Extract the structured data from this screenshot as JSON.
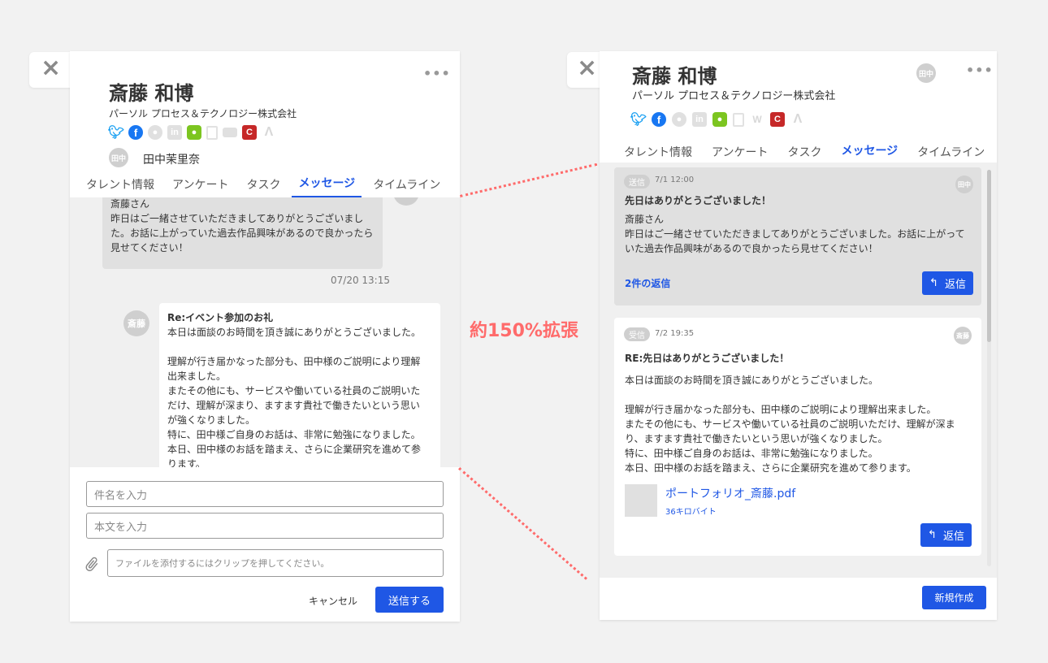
{
  "left": {
    "close_icon": "×",
    "menu_icon": "•••",
    "profile_name": "斎藤 和博",
    "company": "パーソル プロセス＆テクノロジー株式会社",
    "owner_avatar": "田中",
    "owner_name": "田中茉里奈",
    "tabs": [
      "タレント情報",
      "アンケート",
      "タスク",
      "メッセージ",
      "タイムライン"
    ],
    "active_tab": "メッセージ",
    "message1": {
      "text": "斎藤さん\n昨日はご一緒させていただきましてありがとうございまし\nた。お話に上がっていた過去作品興味があるので良かったら\n見せてください！",
      "timestamp": "07/20 13:15"
    },
    "message2": {
      "avatar": "斎藤",
      "subject": "Re:イベント参加のお礼",
      "text": "本日は面談のお時間を頂き誠にありがとうございました。\n\n理解が行き届かなった部分も、田中様のご説明により理解\n出来ました。\nまたその他にも、サービスや働いている社員のご説明いた\nだけ、理解が深まり、ますます貴社で働きたいという思い\nが強くなりました。\n特に、田中様ご自身のお話は、非常に勉強になりました。\n本日、田中様のお話を踏まえ、さらに企業研究を進めて参\nります。"
    },
    "subject_placeholder": "件名を入力",
    "body_placeholder": "本文を入力",
    "file_placeholder": "ファイルを添付するにはクリップを押してください。",
    "cancel_label": "キャンセル",
    "send_label": "送信する"
  },
  "annotation": "約150%拡張",
  "right": {
    "close_icon": "×",
    "menu_icon": "•••",
    "profile_name": "斎藤 和博",
    "company": "パーソル プロセス＆テクノロジー株式会社",
    "owner_avatar": "田中",
    "tabs": [
      "タレント情報",
      "アンケート",
      "タスク",
      "メッセージ",
      "タイムライン"
    ],
    "active_tab": "メッセージ",
    "card1": {
      "badge": "送信",
      "date": "7/1 12:00",
      "avatar": "田中",
      "subject": "先日はありがとうございました！",
      "text": "斎藤さん\n昨日はご一緒させていただきましてありがとうございました。お話に上がって\nいた過去作品興味があるので良かったら見せてください！",
      "replies_link": "2件の返信",
      "reply_label": "返信"
    },
    "card2": {
      "badge": "受信",
      "date": "7/2 19:35",
      "avatar": "斎藤",
      "subject": "RE:先日はありがとうございました！",
      "text": "本日は面談のお時間を頂き誠にありがとうございました。\n\n理解が行き届かなった部分も、田中様のご説明により理解出来ました。\nまたその他にも、サービスや働いている社員のご説明いただけ、理解が深ま\nり、ますます貴社で働きたいという思いが強くなりました。\n特に、田中様ご自身のお話は、非常に勉強になりました。\n本日、田中様のお話を踏まえ、さらに企業研究を進めて参ります。",
      "attachment_name": "ポートフォリオ_斎藤.pdf",
      "attachment_size": "36キロバイト",
      "reply_label": "返信"
    },
    "new_label": "新規作成"
  },
  "colors": {
    "accent": "#1f57e5",
    "annotation": "#ff6b6b",
    "background": "#f2f2f2"
  }
}
